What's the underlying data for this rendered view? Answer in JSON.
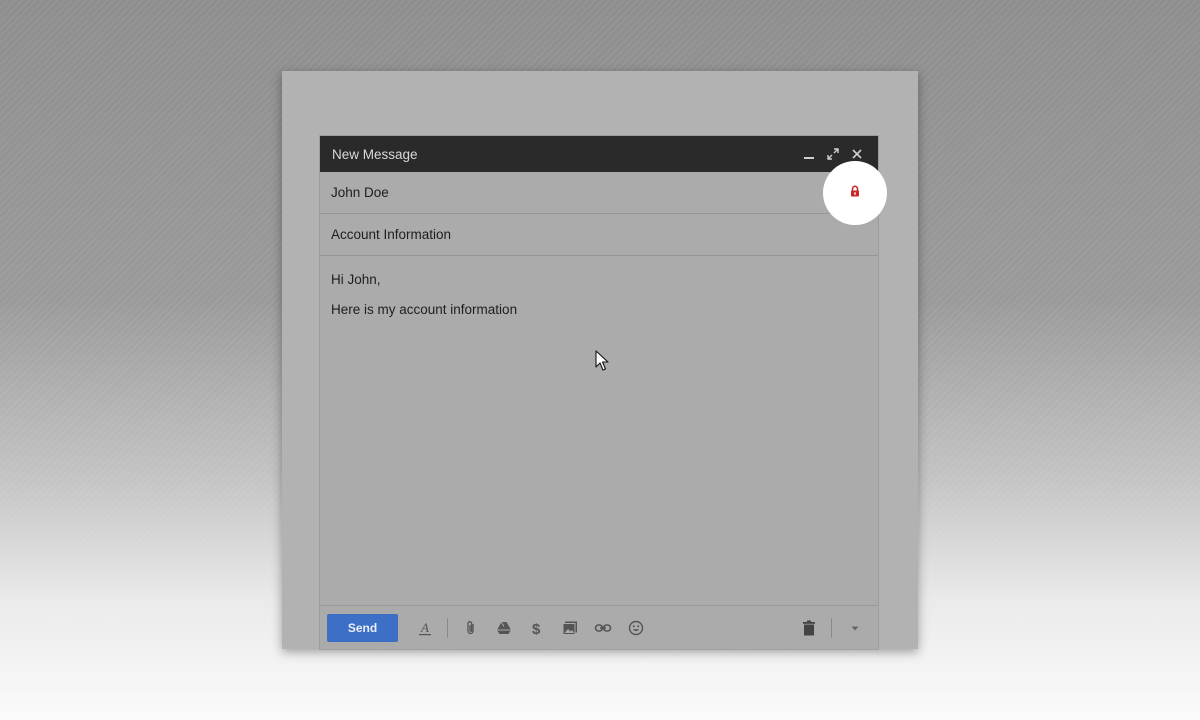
{
  "compose": {
    "title": "New Message",
    "to_value": "John Doe",
    "subject_value": "Account Information",
    "body_lines": [
      "Hi John,",
      "Here is my account information"
    ],
    "send_label": "Send",
    "lock_icon": "lock-icon",
    "colors": {
      "header_bg": "#2a2a2a",
      "send_button": "#3d6fc6",
      "lock": "#c8272c"
    }
  },
  "toolbar_icons": [
    "formatting-icon",
    "attach-icon",
    "drive-icon",
    "money-icon",
    "photo-icon",
    "link-icon",
    "emoji-icon",
    "trash-icon",
    "more-options-icon"
  ]
}
